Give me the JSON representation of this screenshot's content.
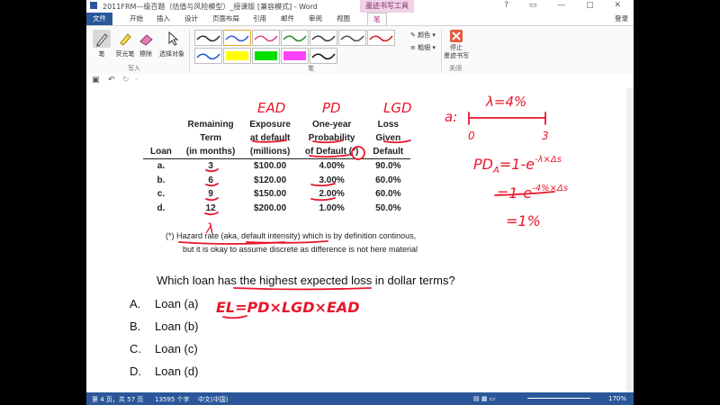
{
  "titlebar": {
    "title": "2011FRM—级百题（估值与风险模型）_授课版 [兼容模式] - Word",
    "context_tab": "墨迹书写工具",
    "login": "登录"
  },
  "tabs": [
    "文件",
    "开始",
    "插入",
    "设计",
    "页面布局",
    "引用",
    "邮件",
    "审阅",
    "视图",
    "笔"
  ],
  "ribbon": {
    "write_tools": [
      {
        "label": "笔",
        "icon": "pen-icon"
      },
      {
        "label": "荧光笔",
        "icon": "highlighter-icon"
      },
      {
        "label": "擦除",
        "icon": "eraser-icon"
      },
      {
        "label": "选择对象",
        "icon": "select-objects-icon"
      }
    ],
    "write_group": "写入",
    "pen_colors": [
      "#333333",
      "#3a5fcd",
      "#d64c8a",
      "#2c8c2c",
      "#444444",
      "#555555",
      "#d62020",
      "#2060d0",
      "#ffff00",
      "#00e000",
      "#ff40ff",
      "#1a1a1a"
    ],
    "color_label": "颜色",
    "thickness_label": "粗细",
    "pen_group": "笔",
    "close_label": "停止\n墨迹书写",
    "close_group": "关闭"
  },
  "document": {
    "headers": {
      "row1": [
        "",
        "Remaining",
        "Exposure",
        "One-year",
        "Loss"
      ],
      "row2": [
        "",
        "Term",
        "at default",
        "Probability",
        "Given"
      ],
      "row3": [
        "Loan",
        "(in months)",
        "(millions)",
        "of Default (*)",
        "Default"
      ]
    },
    "rows": [
      [
        "a.",
        "3",
        "$100.00",
        "4.00%",
        "90.0%"
      ],
      [
        "b.",
        "6",
        "$120.00",
        "3.00%",
        "60.0%"
      ],
      [
        "c.",
        "9",
        "$150.00",
        "2.00%",
        "60.0%"
      ],
      [
        "d.",
        "12",
        "$200.00",
        "1.00%",
        "50.0%"
      ]
    ],
    "footnote1": "(*)  Hazard rate (aka, default intensity) which is by definition continous,",
    "footnote2": "but it is okay to assume discrete as difference is not here material",
    "question": "Which loan has the highest expected loss in dollar terms?",
    "options": [
      {
        "letter": "A.",
        "text": "Loan (a)"
      },
      {
        "letter": "B.",
        "text": "Loan (b)"
      },
      {
        "letter": "C.",
        "text": "Loan (c)"
      },
      {
        "letter": "D.",
        "text": "Loan (d)"
      }
    ]
  },
  "ink": {
    "ead": "EAD",
    "pd": "PD",
    "lgd": "LGD",
    "lambda": "λ",
    "a_label": "a:",
    "lambda_eq": "λ=4%",
    "tick0": "0",
    "tick3": "3",
    "pd_line1": "PD",
    "pd_sub": "A",
    "pd_line1_rest": "=1-e",
    "pd_line1_exp": "-λ×Δs",
    "pd_line2": "=1-e",
    "pd_line2_exp": "-4%×Δs",
    "pd_line3": "=1%",
    "el_formula": "EL=PD×LGD×EAD"
  },
  "status": {
    "page": "第 4 页，共 57 页",
    "words": "13595 个字",
    "lang": "中文(中国)",
    "zoom": "170%"
  }
}
